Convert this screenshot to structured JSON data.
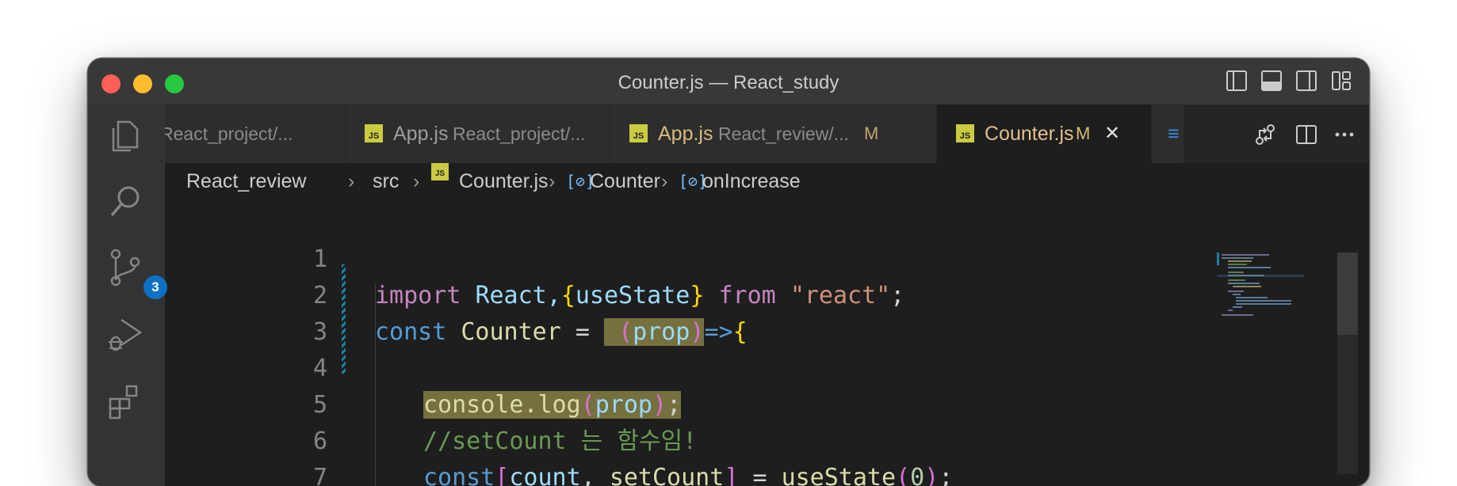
{
  "window": {
    "title": "Counter.js — React_study"
  },
  "activity_bar": {
    "items": [
      "explorer-icon",
      "search-icon",
      "source-control-icon",
      "run-debug-icon",
      "extensions-icon"
    ],
    "source_control_badge": "3"
  },
  "tabs": [
    {
      "name": "",
      "path": "React_project/...",
      "modified": "",
      "active": false
    },
    {
      "name": "App.js",
      "path": "React_project/...",
      "modified": "",
      "active": false
    },
    {
      "name": "App.js",
      "path": "React_review/...",
      "modified": "M",
      "active": false
    },
    {
      "name": "Counter.js",
      "path": "",
      "modified": "M",
      "active": true,
      "close": "✕"
    }
  ],
  "breadcrumb": {
    "folder": "React_review",
    "sub": "src",
    "file": "Counter.js",
    "symbol1": "Counter",
    "symbol2": "onIncrease",
    "separator": "›"
  },
  "editor": {
    "line_numbers": [
      "1",
      "2",
      "3",
      "4",
      "5",
      "6",
      "7"
    ],
    "lines": {
      "l1": {
        "a": "import",
        "b": "React,",
        "c": "{",
        "d": "useState",
        "e": "}",
        "f": "from",
        "g": "\"react\"",
        "h": ";"
      },
      "l2": {
        "a": "const",
        "b": "Counter",
        "c": "=",
        "d": "(",
        "e": "prop",
        "f": ")",
        "g": "=>",
        "h": "{"
      },
      "l4": {
        "a": "console",
        "b": ".",
        "c": "log",
        "d": "(",
        "e": "prop",
        "f": ")",
        "g": ";"
      },
      "l5": {
        "a": "//setCount 는 함수임!"
      },
      "l6": {
        "a": "const",
        "b": "[",
        "c": "count",
        "d": ",",
        "e": "setCount",
        "f": "]",
        "g": "=",
        "h": "useState",
        "i": "(",
        "j": "0",
        "k": ")",
        "l": ";"
      }
    }
  },
  "colors": {
    "keyword": "#c586c0",
    "storage": "#569cd6",
    "variable": "#9cdcfe",
    "function": "#dcdcaa",
    "string": "#ce9178",
    "comment": "#6a9955",
    "highlight": "#76703f",
    "badge": "#0e71c5"
  }
}
